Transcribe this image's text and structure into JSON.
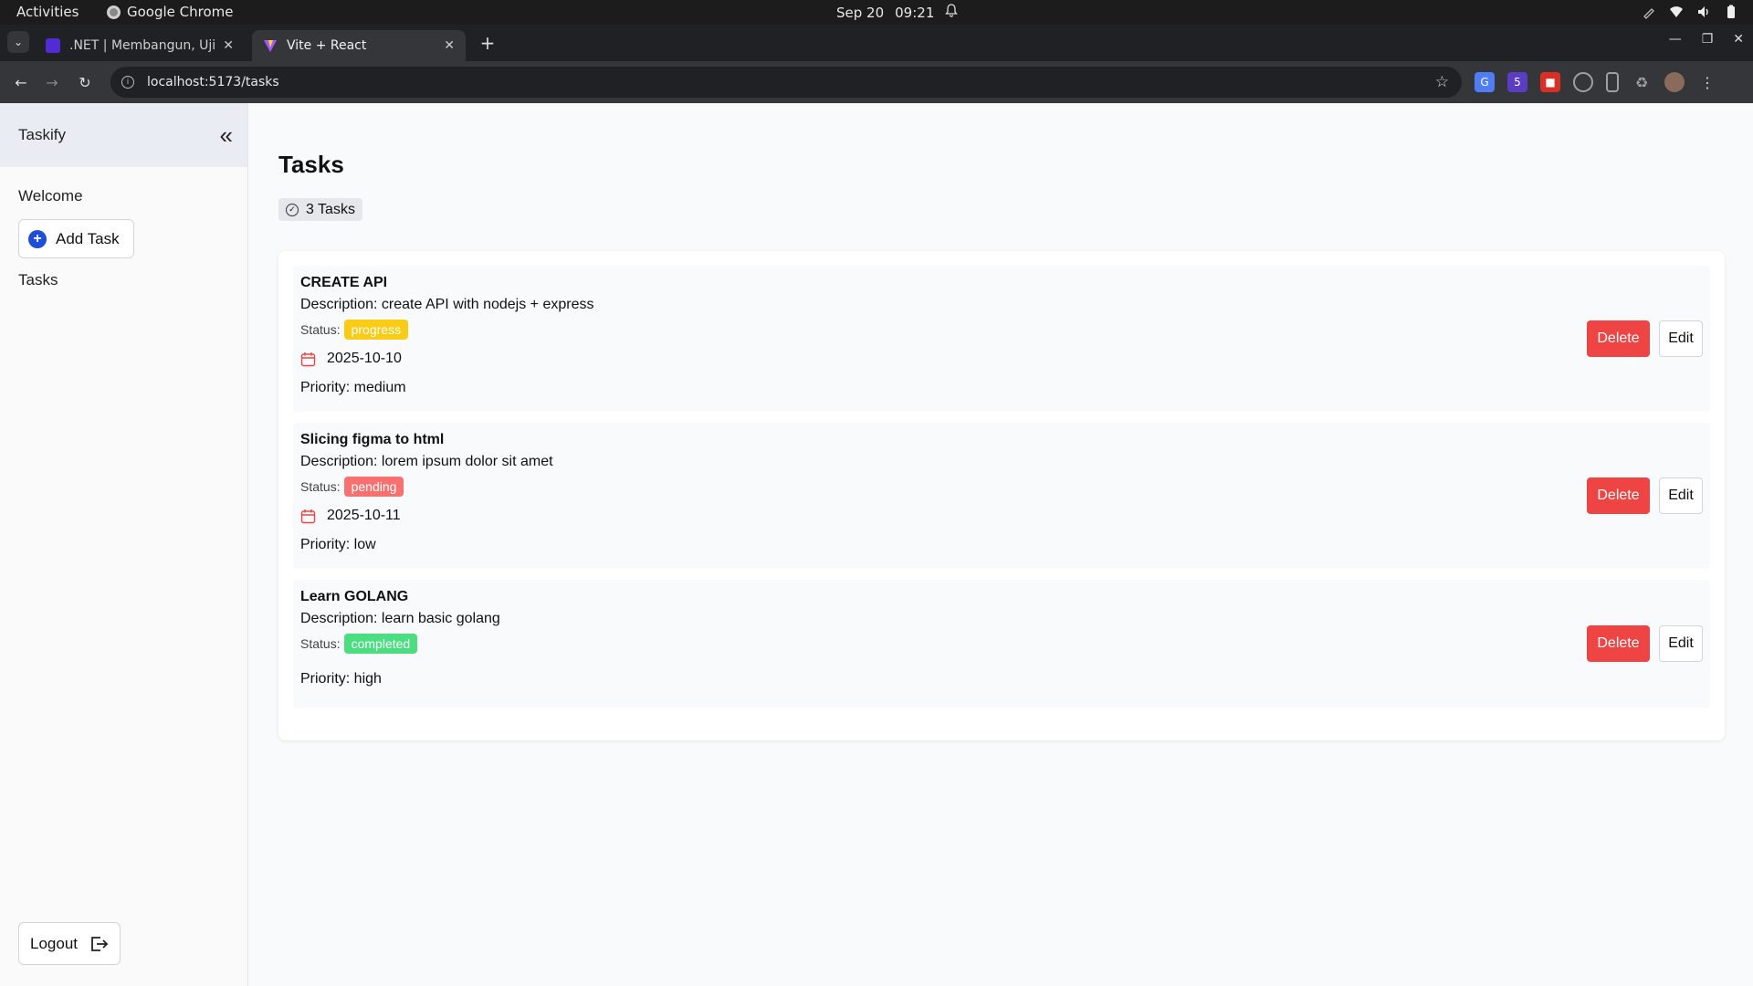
{
  "os": {
    "activities": "Activities",
    "app_name": "Google Chrome",
    "date": "Sep 20",
    "time": "09:21"
  },
  "browser": {
    "tabs": [
      {
        "title": ".NET | Membangun, Uji, S",
        "favicon": "dotnet-icon",
        "active": false
      },
      {
        "title": "Vite + React",
        "favicon": "vite-icon",
        "active": true
      }
    ],
    "url": "localhost:5173/tasks",
    "extensions": [
      {
        "icon": "translate-icon",
        "color": "#4f7cf7"
      },
      {
        "icon": "extension-badge-icon",
        "color": "#5b3cc4",
        "badge": "5"
      },
      {
        "icon": "pdf-icon",
        "color": "#d93025"
      },
      {
        "icon": "target-icon",
        "color": "#9aa0a6"
      },
      {
        "icon": "device-icon",
        "color": "#9aa0a6"
      },
      {
        "icon": "puzzle-icon",
        "color": "#9aa0a6"
      },
      {
        "icon": "profile-avatar-icon",
        "color": "#8a6a5a"
      }
    ]
  },
  "sidebar": {
    "brand": "Taskify",
    "welcome": "Welcome",
    "add_task_label": "Add Task",
    "nav_tasks": "Tasks",
    "logout_label": "Logout"
  },
  "main": {
    "title": "Tasks",
    "count_label": "3 Tasks",
    "tasks": [
      {
        "title": "CREATE API",
        "description": "Description: create API with nodejs + express",
        "status_label": "Status:",
        "status": "progress",
        "status_color": "#facc15",
        "date": "2025-10-10",
        "priority": "Priority: medium",
        "delete_label": "Delete",
        "edit_label": "Edit"
      },
      {
        "title": "Slicing figma to html",
        "description": "Description: lorem ipsum dolor sit amet",
        "status_label": "Status:",
        "status": "pending",
        "status_color": "#f87171",
        "date": "2025-10-11",
        "priority": "Priority: low",
        "delete_label": "Delete",
        "edit_label": "Edit"
      },
      {
        "title": "Learn GOLANG",
        "description": "Description: learn basic golang",
        "status_label": "Status:",
        "status": "completed",
        "status_color": "#4ade80",
        "date": "",
        "priority": "Priority: high",
        "delete_label": "Delete",
        "edit_label": "Edit"
      }
    ]
  }
}
